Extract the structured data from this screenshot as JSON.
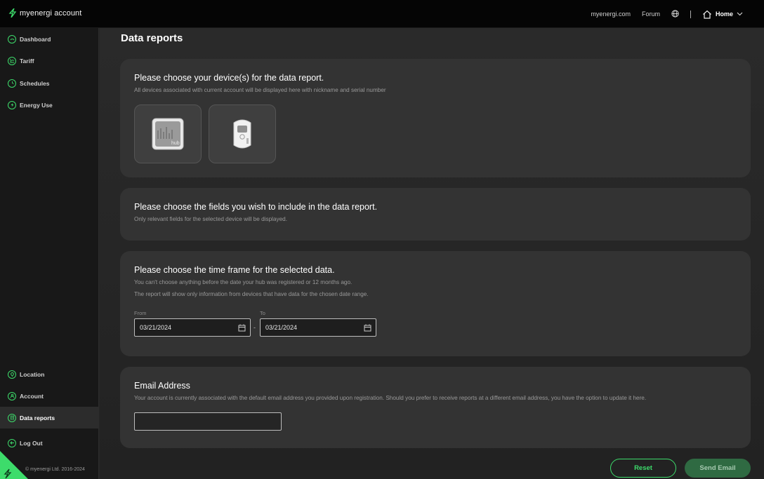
{
  "header": {
    "brand": "myenergi account",
    "links": [
      "myenergi.com",
      "Forum"
    ],
    "home_label": "Home"
  },
  "sidebar": {
    "top_items": [
      {
        "label": "Dashboard",
        "icon": "dashboard-icon"
      },
      {
        "label": "Tariff",
        "icon": "tariff-icon"
      },
      {
        "label": "Schedules",
        "icon": "clock-icon"
      },
      {
        "label": "Energy Use",
        "icon": "bolt-icon"
      }
    ],
    "bottom_items": [
      {
        "label": "Location",
        "icon": "location-icon"
      },
      {
        "label": "Account",
        "icon": "account-icon"
      },
      {
        "label": "Data reports",
        "icon": "data-reports-icon",
        "active": true
      },
      {
        "label": "Log Out",
        "icon": "logout-icon"
      }
    ],
    "copyright": "© myenergi Ltd. 2016-2024"
  },
  "page": {
    "title": "Data reports"
  },
  "devices_card": {
    "heading": "Please choose your device(s) for the data report.",
    "subtext": "All devices associated with current account will be displayed here with nickname and serial number",
    "devices": [
      {
        "name": "hub",
        "icon": "hub-device-icon"
      },
      {
        "name": "eddi",
        "icon": "eddi-device-icon"
      }
    ]
  },
  "fields_card": {
    "heading": "Please choose the fields you wish to include in the data report.",
    "subtext": "Only relevant fields for the selected device will be displayed."
  },
  "timeframe_card": {
    "heading": "Please choose the time frame for the selected data.",
    "subtext1": "You can't choose anything before the date your hub was registered or 12 months ago.",
    "subtext2": "The report will show only information from devices that have data for the chosen date range.",
    "from_label": "From",
    "to_label": "To",
    "from_value": "03/21/2024",
    "to_value": "03/21/2024",
    "separator": "-"
  },
  "email_card": {
    "heading": "Email Address",
    "subtext": "Your account is currently associated with the default email address you provided upon registration. Should you prefer to receive reports at a different email address, you have the option to update it here.",
    "value": ""
  },
  "actions": {
    "reset_label": "Reset",
    "send_label": "Send Email"
  },
  "colors": {
    "accent": "#3ddc6b",
    "send_button_bg": "#2f6a42",
    "card_bg": "#333333",
    "topbar_bg": "#050505"
  }
}
